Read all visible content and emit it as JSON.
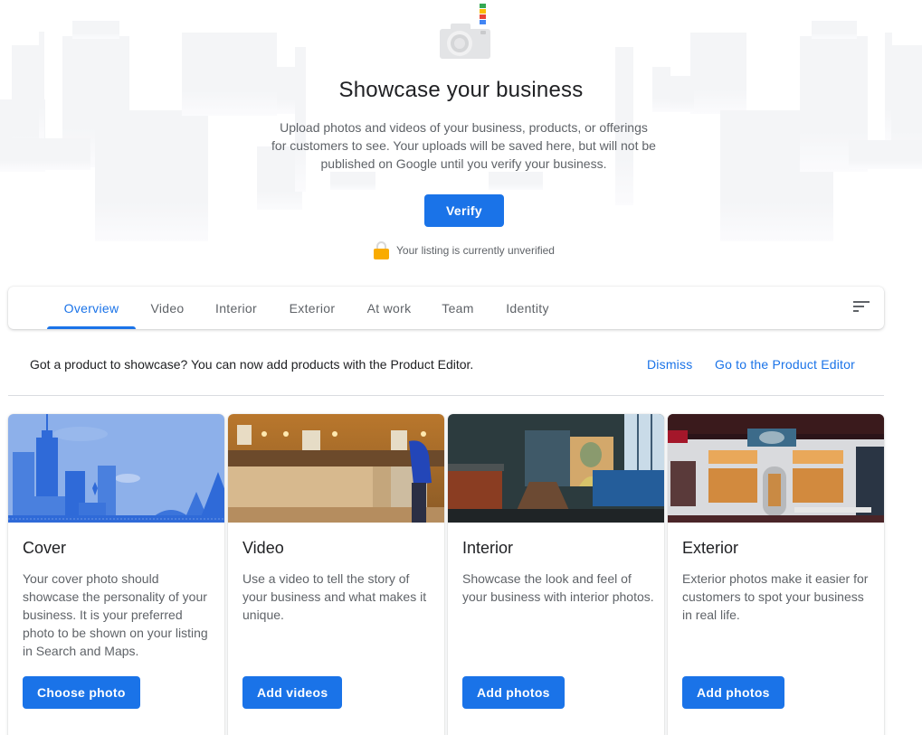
{
  "hero": {
    "title": "Showcase your business",
    "description": "Upload photos and videos of your business, products, or offerings for customers to see. Your uploads will be saved here, but will not be published on Google until you verify your business.",
    "verify_label": "Verify",
    "status_text": "Your listing is currently unverified",
    "camera_icon_colors": [
      "#34a853",
      "#fbbc04",
      "#ea4335",
      "#4285f4"
    ]
  },
  "tabs": {
    "active": "Overview",
    "items": [
      {
        "label": "Overview"
      },
      {
        "label": "Video"
      },
      {
        "label": "Interior"
      },
      {
        "label": "Exterior"
      },
      {
        "label": "At work"
      },
      {
        "label": "Team"
      },
      {
        "label": "Identity"
      }
    ],
    "sort_icon": "sort-icon"
  },
  "banner": {
    "text": "Got a product to showcase? You can now add products with the Product Editor.",
    "dismiss_label": "Dismiss",
    "product_editor_label": "Go to the Product Editor"
  },
  "cards": [
    {
      "title": "Cover",
      "description": "Your cover photo should showcase the personality of your business. It is your preferred photo to be shown on your listing in Search and Maps.",
      "button": "Choose photo",
      "image": "city-skyline-illustration"
    },
    {
      "title": "Video",
      "description": "Use a video to tell the story of your business and what makes it unique.",
      "button": "Add videos",
      "image": "shop-counter-photo"
    },
    {
      "title": "Interior",
      "description": "Showcase the look and feel of your business with interior photos.",
      "button": "Add photos",
      "image": "restaurant-interior-photo"
    },
    {
      "title": "Exterior",
      "description": "Exterior photos make it easier for customers to spot your business in real life.",
      "button": "Add photos",
      "image": "storefront-exterior-photo"
    }
  ],
  "colors": {
    "accent": "#1a73e8",
    "lock": "#f9ab00",
    "text_primary": "#202124",
    "text_secondary": "#5f6368"
  }
}
